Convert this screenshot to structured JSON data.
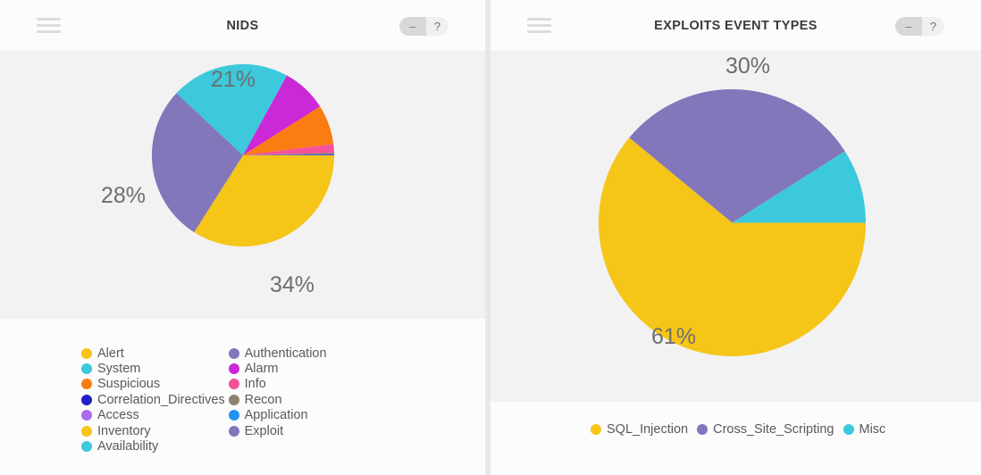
{
  "panels": [
    {
      "id": "nids",
      "title": "NIDS",
      "menu_icon": "hamburger-menu-icon",
      "minimize_label": "–",
      "help_label": "?",
      "percent_labels": [
        "21%",
        "28%",
        "34%"
      ],
      "legend_columns": [
        [
          {
            "label": "Alert",
            "color": "#f5c518"
          },
          {
            "label": "System",
            "color": "#3bc9db"
          },
          {
            "label": "Suspicious",
            "color": "#fb7c13"
          },
          {
            "label": "Correlation_Directives",
            "color": "#2020c8"
          },
          {
            "label": "Access",
            "color": "#a96ced"
          },
          {
            "label": "Inventory",
            "color": "#f5c518"
          },
          {
            "label": "Availability",
            "color": "#3bc9db"
          }
        ],
        [
          {
            "label": "Authentication",
            "color": "#8377bb"
          },
          {
            "label": "Alarm",
            "color": "#cb28d8"
          },
          {
            "label": "Info",
            "color": "#f5529a"
          },
          {
            "label": "Recon",
            "color": "#8b8270"
          },
          {
            "label": "Application",
            "color": "#2393ef"
          },
          {
            "label": "Exploit",
            "color": "#8377bb"
          }
        ]
      ]
    },
    {
      "id": "exploits-event-types",
      "title": "EXPLOITS EVENT TYPES",
      "menu_icon": "hamburger-menu-icon",
      "minimize_label": "–",
      "help_label": "?",
      "percent_labels": [
        "30%",
        "61%"
      ],
      "legend_columns": [
        [
          {
            "label": "SQL_Injection",
            "color": "#f5c518"
          },
          {
            "label": "Cross_Site_Scripting",
            "color": "#8377bb"
          },
          {
            "label": "Misc",
            "color": "#3bc9db"
          }
        ]
      ]
    }
  ],
  "chart_data": [
    {
      "type": "pie",
      "title": "NIDS",
      "labels": [
        "Alert",
        "Authentication",
        "System",
        "Alarm",
        "Suspicious",
        "Info",
        "Recon",
        "Correlation_Directives",
        "Application",
        "Access",
        "Exploit",
        "Inventory",
        "Availability"
      ],
      "values": [
        34,
        28,
        21,
        8,
        7,
        0.6,
        0.5,
        0.4,
        0.3,
        0.1,
        0.1,
        0.05,
        0.05
      ],
      "display_percents": [
        "34%",
        "28%",
        "21%"
      ],
      "colors": [
        "#f5c518",
        "#8377bb",
        "#3bc9db",
        "#cb28d8",
        "#fb7c13",
        "#f5529a",
        "#8b8270",
        "#2020c8",
        "#2393ef",
        "#a96ced",
        "#8377bb",
        "#f5c518",
        "#3bc9db"
      ],
      "unit": "%",
      "legend_position": "bottom"
    },
    {
      "type": "pie",
      "title": "EXPLOITS EVENT TYPES",
      "labels": [
        "SQL_Injection",
        "Cross_Site_Scripting",
        "Misc"
      ],
      "values": [
        61,
        30,
        9
      ],
      "display_percents": [
        "61%",
        "30%"
      ],
      "colors": [
        "#f5c518",
        "#8377bb",
        "#3bc9db"
      ],
      "unit": "%",
      "legend_position": "bottom"
    }
  ]
}
